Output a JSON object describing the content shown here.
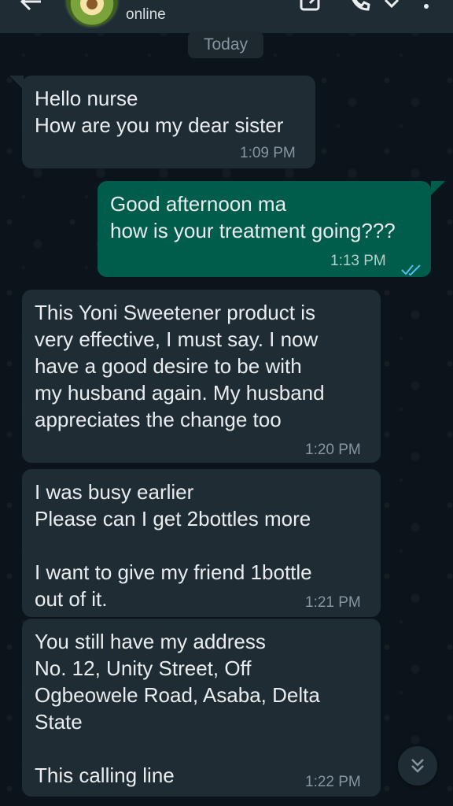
{
  "header": {
    "status": "online"
  },
  "date_chip": "Today",
  "messages": [
    {
      "direction": "in",
      "text": "Hello nurse\nHow are you my dear sister",
      "time": "1:09 PM"
    },
    {
      "direction": "out",
      "text": "Good afternoon ma\nhow is your treatment going???",
      "time": "1:13 PM",
      "read": true
    },
    {
      "direction": "in",
      "text": "This Yoni Sweetener product is\nvery effective, I must say. I now\nhave a good desire to be with\nmy husband again. My husband\nappreciates the change too",
      "time": "1:20 PM"
    },
    {
      "direction": "in",
      "text": "I was busy earlier\nPlease can I get 2bottles more\n\nI want to give my friend 1bottle\nout of it.",
      "time": "1:21 PM"
    },
    {
      "direction": "in",
      "text": "You still have my address\nNo. 12, Unity Street, Off\nOgbeowele Road, Asaba, Delta\nState\n\nThis calling line",
      "time": "1:22 PM"
    }
  ],
  "icons": {
    "back": "arrow-left-icon",
    "edit": "edit-icon",
    "call": "phone-icon",
    "dropdown": "chevron-down-icon",
    "menu": "more-vert-icon",
    "read_receipt": "double-check-icon",
    "scroll": "double-chevron-down-icon"
  },
  "colors": {
    "background": "#0b141a",
    "incoming_bubble": "#1f2c34",
    "outgoing_bubble": "#005c4b",
    "read_tick": "#53bdeb"
  }
}
